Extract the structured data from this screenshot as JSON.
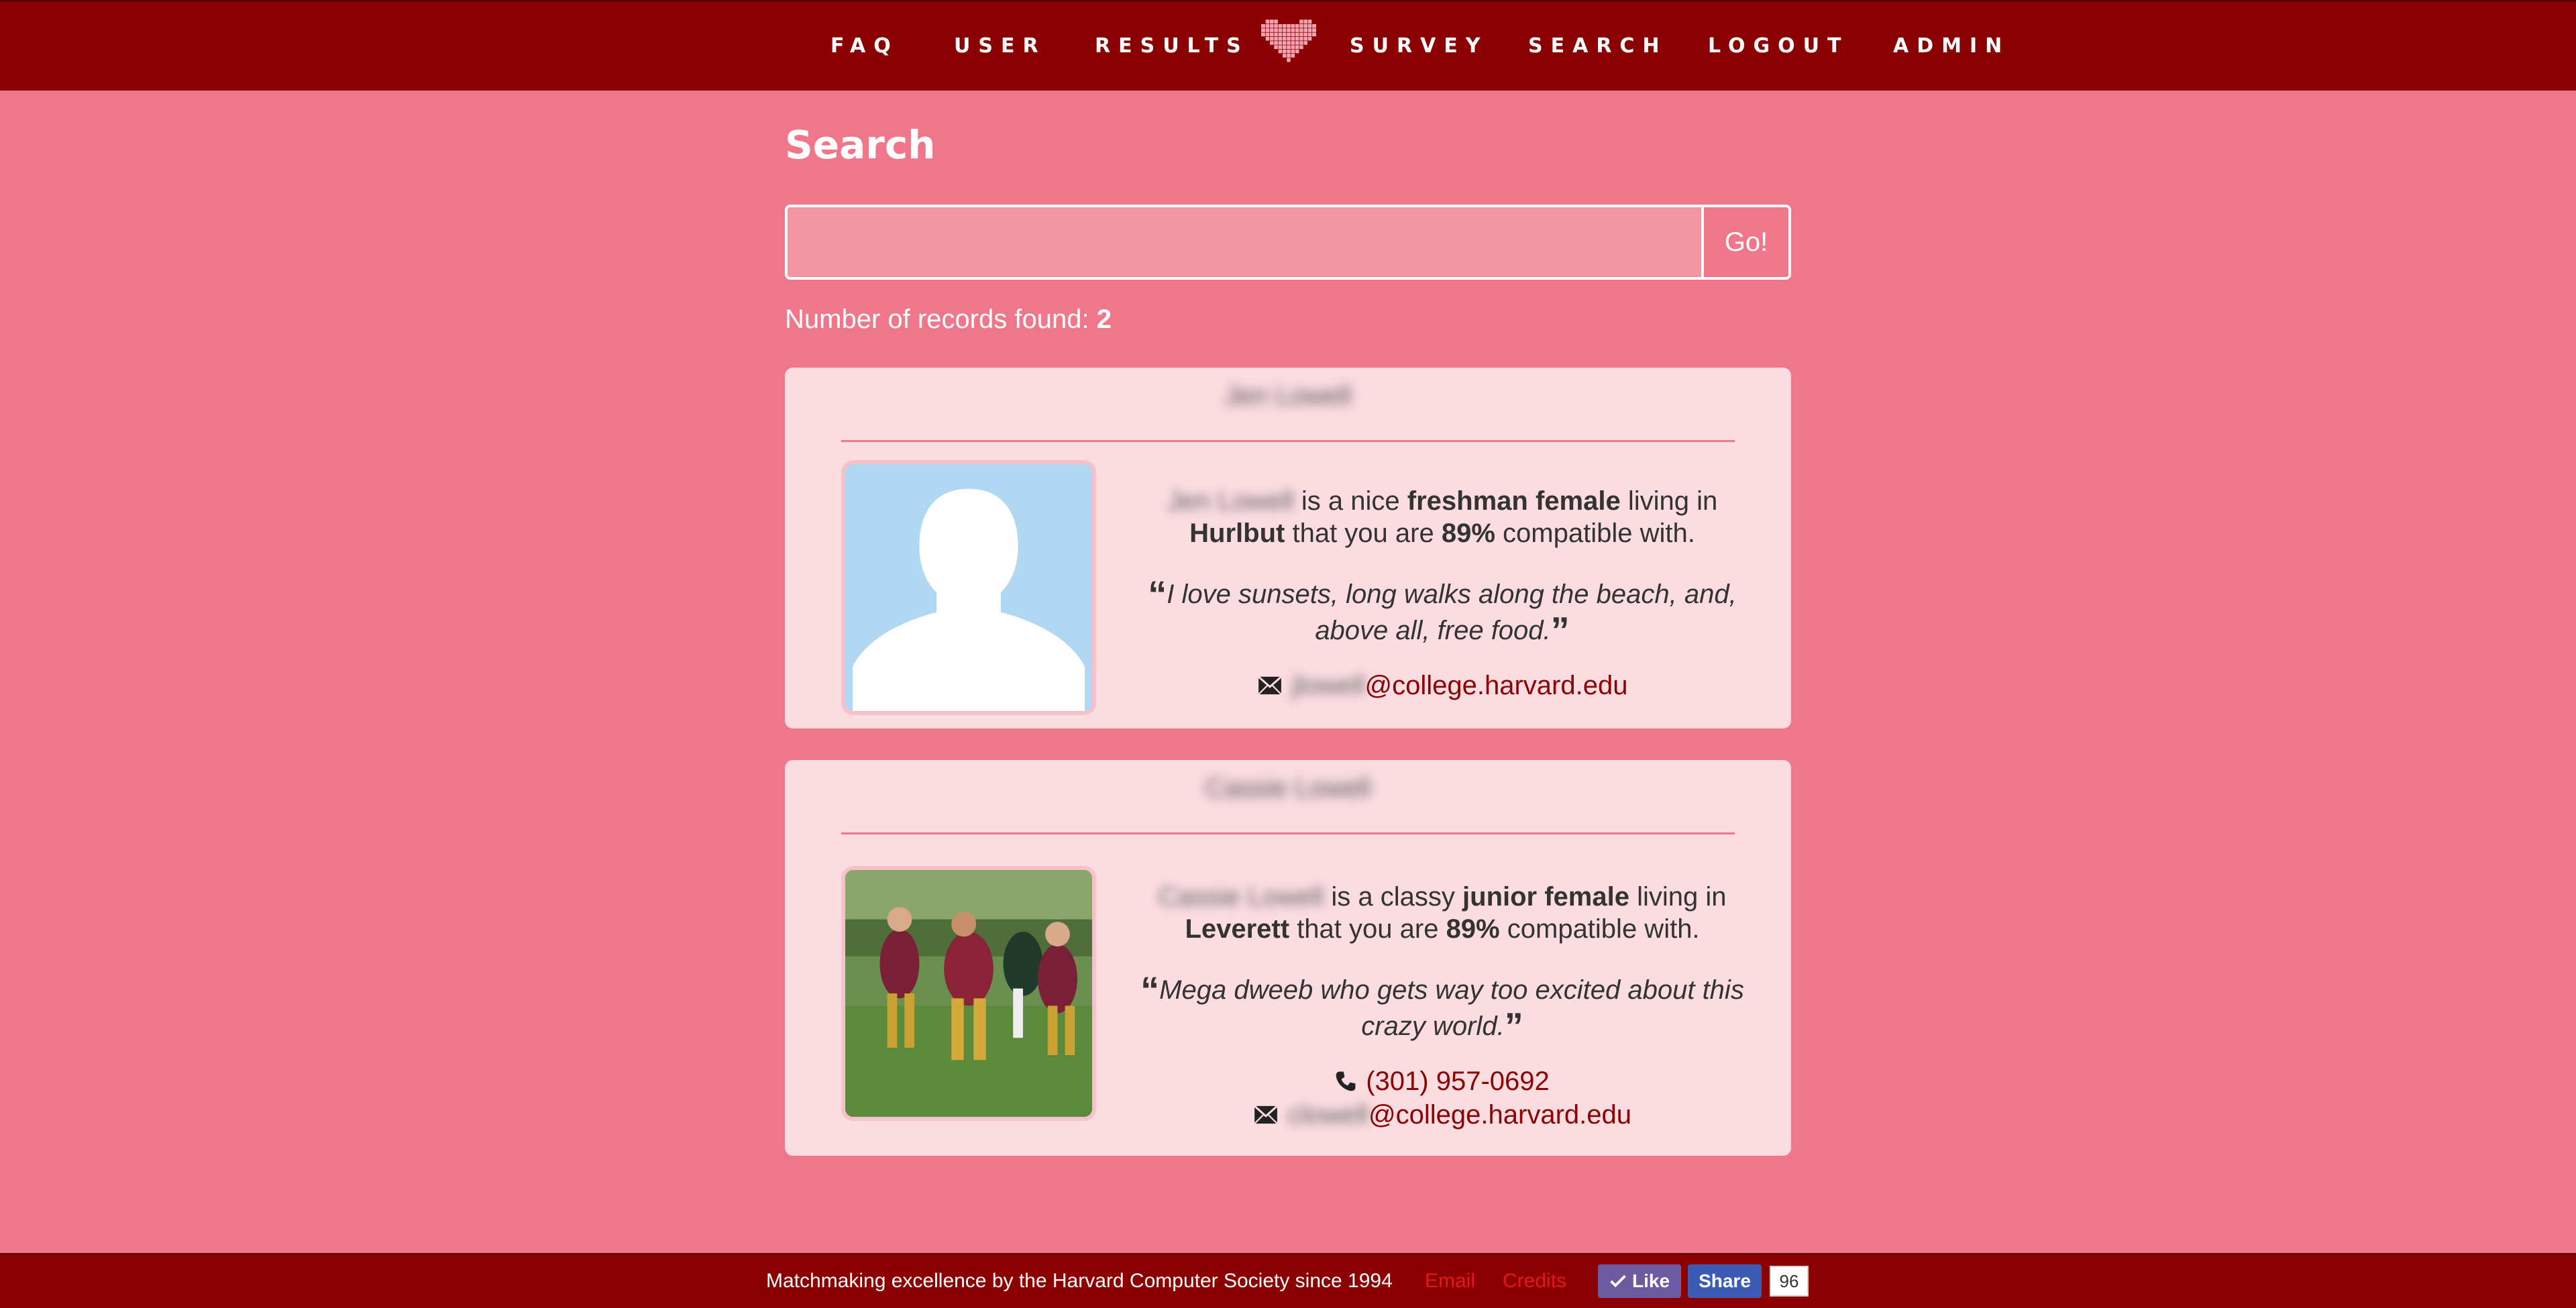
{
  "nav": {
    "faq": "FAQ",
    "user": "USER",
    "results": "RESULTS",
    "survey": "SURVEY",
    "search": "SEARCH",
    "logout": "LOGOUT",
    "admin": "ADMIN",
    "logo_icon": "pixel-heart-icon"
  },
  "main": {
    "title": "Search",
    "search": {
      "value": "",
      "placeholder": "",
      "go_label": "Go!"
    },
    "records_label": "Number of records found:",
    "records_count": "2"
  },
  "results": [
    {
      "name": "Jen Lowell",
      "name_in_sentence": "Jen Lowell",
      "adjective_prefix": "is a nice",
      "year_gender": "freshman female",
      "living_in": "living in",
      "house": "Hurlbut",
      "compat_prefix": "that you are",
      "compatibility": "89%",
      "compat_suffix": "compatible with.",
      "quote": "I love sunsets, long walks along the beach, and, above all, free food.",
      "email_user": "jlowell",
      "email_domain": "@college.harvard.edu",
      "photo": "default-avatar"
    },
    {
      "name": "Cassie Lowell",
      "name_in_sentence": "Cassie Lowell",
      "adjective_prefix": "is a classy",
      "year_gender": "junior female",
      "living_in": "living in",
      "house": "Leverett",
      "compat_prefix": "that you are",
      "compatibility": "89%",
      "compat_suffix": "compatible with.",
      "quote": "Mega dweeb who gets way too excited about this crazy world.",
      "phone": "(301) 957-0692",
      "email_user": "clowell",
      "email_domain": "@college.harvard.edu",
      "photo": "rugby-photo"
    }
  ],
  "quote_open": "“",
  "quote_close": "”",
  "footer": {
    "text": "Matchmaking excellence by the Harvard Computer Society since 1994",
    "email": "Email",
    "credits": "Credits",
    "like": "Like",
    "share": "Share",
    "like_count": "96"
  },
  "colors": {
    "background": "#f07789",
    "bar": "#8b0000",
    "card": "#fbdce1",
    "link": "#8b0000"
  }
}
